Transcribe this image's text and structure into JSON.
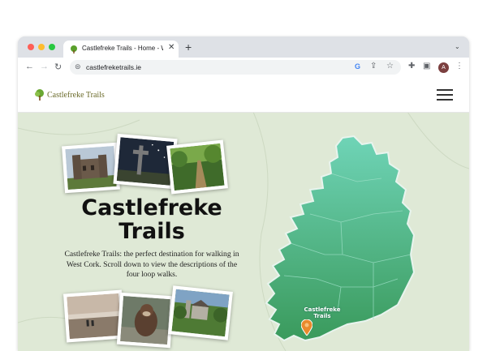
{
  "browser": {
    "tab_title": "Castlefreke Trails - Home - We",
    "tab_close": "✕",
    "new_tab": "+",
    "tab_menu": "⌄",
    "url": "castlefreketrails.ie",
    "google_icon": "G",
    "avatar_letter": "A",
    "icons": {
      "back": "←",
      "forward": "→",
      "reload": "↻",
      "site_info": "⊜",
      "share": "⇪",
      "star": "☆",
      "extensions": "✚",
      "sidepanel": "▣",
      "menu": "⋮"
    },
    "traffic_light_colors": [
      "#ff5f57",
      "#febc2e",
      "#28c840"
    ]
  },
  "site": {
    "logo_text": "Castlefreke Trails",
    "hero_title": "Castlefreke Trails",
    "hero_description": "Castlefreke Trails: the perfect destination for walking in West Cork. Scroll down to view the descriptions of the four loop walks.",
    "map_label": "Castlefreke Trails"
  },
  "colors": {
    "hero_background": "#dfe9d6",
    "map_top": "#6fd4b7",
    "map_bottom": "#3a9a5c",
    "pin": "#e98a2c"
  }
}
